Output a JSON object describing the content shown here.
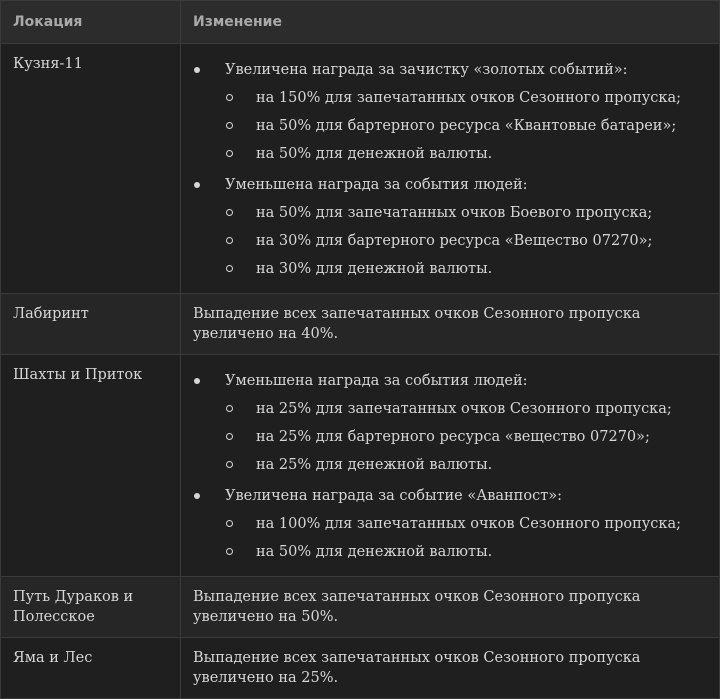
{
  "table": {
    "headers": {
      "location": "Локация",
      "change": "Изменение"
    },
    "rows": [
      {
        "location": "Кузня-11",
        "groups": [
          {
            "title": "Увеличена награда за зачистку «золотых событий»:",
            "items": [
              "на 150% для запечатанных очков Сезонного пропуска;",
              "на 50% для бартерного ресурса «Квантовые батареи»;",
              "на 50% для денежной валюты."
            ]
          },
          {
            "title": "Уменьшена награда за события людей:",
            "items": [
              "на 50% для запечатанных очков Боевого пропуска;",
              "на 30% для бартерного ресурса «Вещество 07270»;",
              "на 30% для денежной валюты."
            ]
          }
        ]
      },
      {
        "location": "Лабиринт",
        "text": "Выпадение всех запечатанных очков Сезонного пропуска увеличено на 40%."
      },
      {
        "location": "Шахты и Приток",
        "groups": [
          {
            "title": "Уменьшена награда за события людей:",
            "items": [
              "на 25% для запечатанных очков Сезонного пропуска;",
              "на 25% для бартерного ресурса «вещество 07270»;",
              "на 25% для денежной валюты."
            ]
          },
          {
            "title": "Увеличена награда за событие «Аванпост»:",
            "items": [
              "на 100% для запечатанных очков Сезонного пропуска;",
              "на 50% для денежной валюты."
            ]
          }
        ]
      },
      {
        "location": "Путь Дураков и Полесское",
        "text": "Выпадение всех запечатанных очков Сезонного пропуска увеличено на 50%."
      },
      {
        "location": "Яма и Лес",
        "text": "Выпадение всех запечатанных очков Сезонного пропуска увеличено на 25%."
      }
    ]
  }
}
